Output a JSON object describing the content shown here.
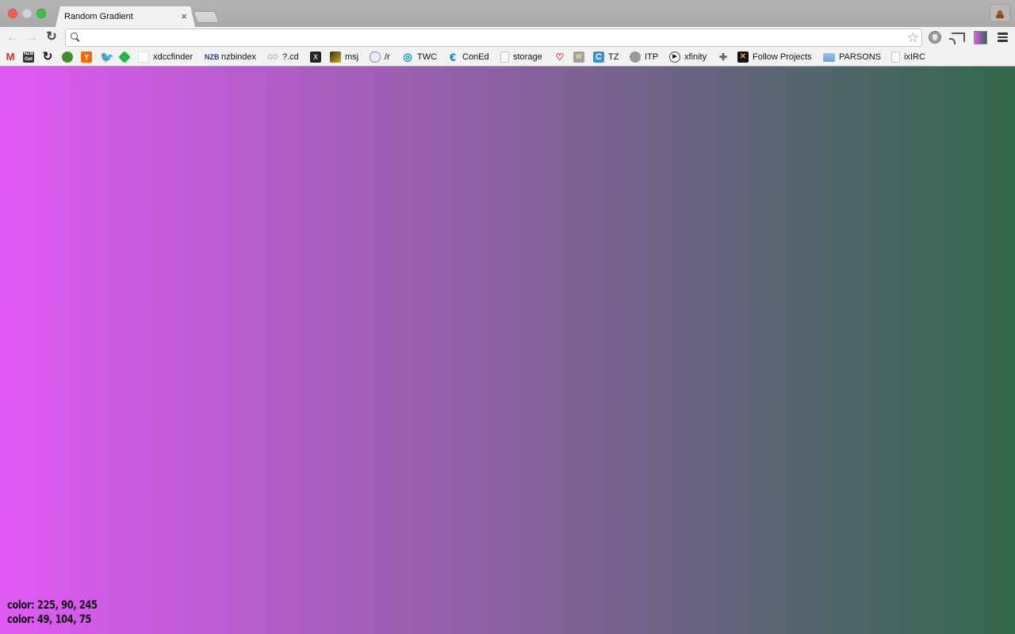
{
  "window": {
    "tab_title": "Random Gradient",
    "tab_close_glyph": "×"
  },
  "toolbar": {
    "back_glyph": "←",
    "forward_glyph": "→",
    "reload_glyph": "↻",
    "omnibox_value": "",
    "star_glyph": "☆",
    "extensions": [
      "adblock-icon",
      "cast-icon",
      "random-gradient-extension-icon"
    ],
    "menu_icon": "hamburger-menu-icon"
  },
  "bookmarks": [
    {
      "label": "",
      "icon": "gmail-icon"
    },
    {
      "label": "",
      "icon": "nzbget-icon"
    },
    {
      "label": "",
      "icon": "refresh-circle-icon"
    },
    {
      "label": "",
      "icon": "turtle-icon"
    },
    {
      "label": "",
      "icon": "hacker-news-icon"
    },
    {
      "label": "",
      "icon": "twitter-icon"
    },
    {
      "label": "",
      "icon": "feedly-icon"
    },
    {
      "label": "xdccfinder",
      "icon": "blank-page-icon"
    },
    {
      "label": "nzbindex",
      "icon": "nzb-icon"
    },
    {
      "label": "?.cd",
      "icon": "cd-icon"
    },
    {
      "label": "",
      "icon": "x-box-icon"
    },
    {
      "label": "msj",
      "icon": "msj-icon"
    },
    {
      "label": "/r",
      "icon": "reddit-icon"
    },
    {
      "label": "TWC",
      "icon": "twc-icon"
    },
    {
      "label": "ConEd",
      "icon": "coned-icon"
    },
    {
      "label": "storage",
      "icon": "page-icon"
    },
    {
      "label": "",
      "icon": "heart-robot-icon"
    },
    {
      "label": "",
      "icon": "w-icon"
    },
    {
      "label": "TZ",
      "icon": "tz-icon"
    },
    {
      "label": "ITP",
      "icon": "chat-bubble-icon"
    },
    {
      "label": "xfinity",
      "icon": "play-circle-icon"
    },
    {
      "label": "",
      "icon": "puzzle-icon"
    },
    {
      "label": "Follow Projects",
      "icon": "skull-icon"
    },
    {
      "label": "PARSONS",
      "icon": "folder-icon"
    },
    {
      "label": "ixIRC",
      "icon": "page-icon"
    }
  ],
  "gradient": {
    "start_color": "#e15af5",
    "end_color": "#31684b",
    "direction": "left-to-right"
  },
  "readout": {
    "line1": "color: 225, 90, 245",
    "line2": "color: 49, 104, 75"
  }
}
